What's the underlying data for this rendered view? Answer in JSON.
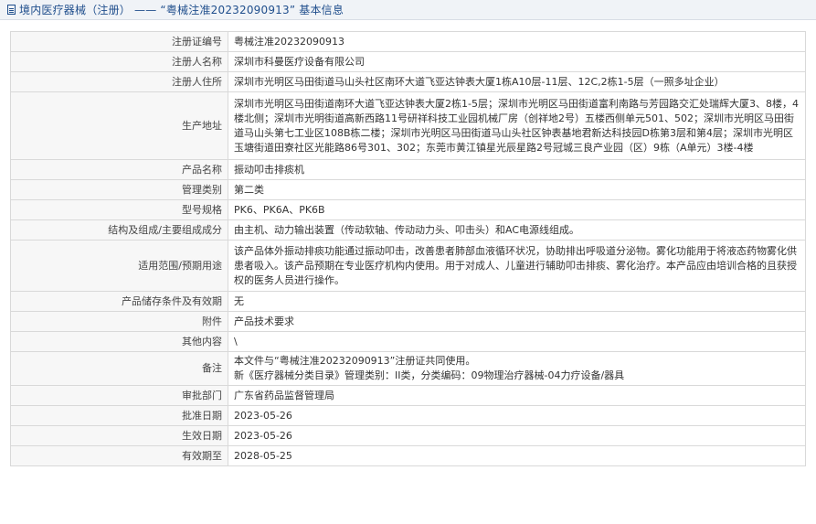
{
  "header": {
    "title": "境内医疗器械（注册） —— “粤械注准20232090913” 基本信息"
  },
  "rows": [
    {
      "label": "注册证编号",
      "value": "粤械注准20232090913"
    },
    {
      "label": "注册人名称",
      "value": "深圳市科曼医疗设备有限公司"
    },
    {
      "label": "注册人住所",
      "value": "深圳市光明区马田街道马山头社区南环大道飞亚达钟表大厦1栋A10层-11层、12C,2栋1-5层（一照多址企业）"
    },
    {
      "label": "生产地址",
      "value": "深圳市光明区马田街道南环大道飞亚达钟表大厦2栋1-5层；深圳市光明区马田街道富利南路与芳园路交汇处瑞辉大厦3、8楼，4楼北侧；深圳市光明街道高新西路11号研祥科技工业园机械厂房（创祥地2号）五楼西侧单元501、502；深圳市光明区马田街道马山头第七工业区108B栋二楼；深圳市光明区马田街道马山头社区钟表基地君新达科技园D栋第3层和第4层；深圳市光明区玉塘街道田寮社区光能路86号301、302；东莞市黄江镇星光辰星路2号冠城三良产业园（区）9栋（A单元）3楼-4楼"
    },
    {
      "label": "产品名称",
      "value": "振动叩击排痰机"
    },
    {
      "label": "管理类别",
      "value": "第二类"
    },
    {
      "label": "型号规格",
      "value": "PK6、PK6A、PK6B"
    },
    {
      "label": "结构及组成/主要组成成分",
      "value": "由主机、动力输出装置（传动软轴、传动动力头、叩击头）和AC电源线组成。"
    },
    {
      "label": "适用范围/预期用途",
      "value": "该产品体外振动排痰功能通过振动叩击，改善患者肺部血液循环状况，协助排出呼吸道分泌物。雾化功能用于将液态药物雾化供患者吸入。该产品预期在专业医疗机构内使用。用于对成人、儿童进行辅助叩击排痰、雾化治疗。本产品应由培训合格的且获授权的医务人员进行操作。"
    },
    {
      "label": "产品储存条件及有效期",
      "value": "无"
    },
    {
      "label": "附件",
      "value": "产品技术要求"
    },
    {
      "label": "其他内容",
      "value": "\\"
    },
    {
      "label": "备注",
      "value_line1": "本文件与“粤械注准20232090913”注册证共同使用。",
      "value_line2": "新《医疗器械分类目录》管理类别：II类，分类编码：09物理治疗器械-04力疗设备/器具"
    },
    {
      "label": "审批部门",
      "value": "广东省药品监督管理局"
    },
    {
      "label": "批准日期",
      "value": "2023-05-26"
    },
    {
      "label": "生效日期",
      "value": "2023-05-26"
    },
    {
      "label": "有效期至",
      "value": "2028-05-25"
    }
  ],
  "colors": {
    "header_text": "#1f4e8c",
    "header_bg": "#f0f3f7",
    "label_bg": "#f7f7f7",
    "border": "#d9d9d9"
  },
  "icons": {
    "header_icon": "document-icon"
  }
}
